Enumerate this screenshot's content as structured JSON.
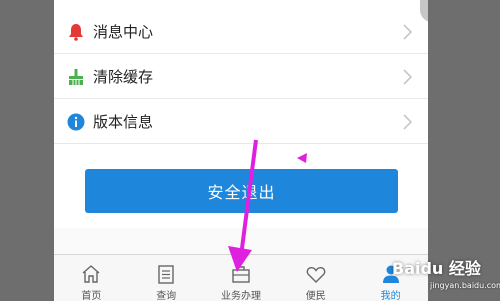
{
  "menu": {
    "items": [
      {
        "label": "消息中心",
        "icon": "bell-icon",
        "icon_color": "#e53935"
      },
      {
        "label": "清除缓存",
        "icon": "broom-icon",
        "icon_color": "#4caf50"
      },
      {
        "label": "版本信息",
        "icon": "info-icon",
        "icon_color": "#1e86db"
      }
    ]
  },
  "logout": {
    "label": "安全退出",
    "color": "#1e86db"
  },
  "tabbar": {
    "tabs": [
      {
        "label": "首页",
        "icon": "home-icon"
      },
      {
        "label": "查询",
        "icon": "document-icon"
      },
      {
        "label": "业务办理",
        "icon": "briefcase-icon"
      },
      {
        "label": "便民",
        "icon": "heart-icon"
      },
      {
        "label": "我的",
        "icon": "person-icon",
        "active": true
      }
    ],
    "active_color": "#1e86db"
  },
  "annotation": {
    "arrow_color": "#e020e0"
  },
  "watermark": {
    "text": "Baidu 经验",
    "sub": "jingyan.baidu.com"
  }
}
